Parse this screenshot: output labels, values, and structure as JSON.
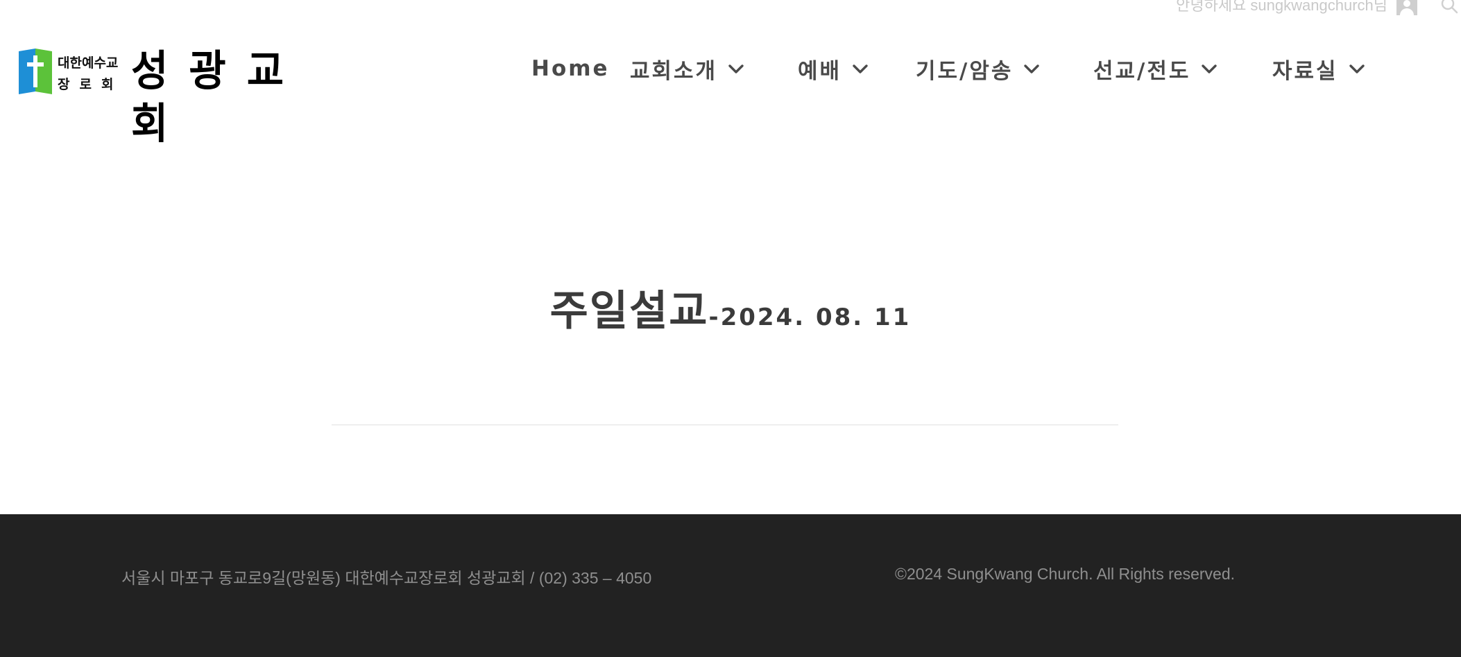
{
  "topbar": {
    "greeting": "안녕하세요 sungkwangchurch님",
    "user_icon": "user-icon",
    "search_icon": "search-icon"
  },
  "logo": {
    "denomination_line1": "대한예수교",
    "denomination_line2": "장로회",
    "church_name": "성광교회",
    "cross_colors": [
      "#1e8fd6",
      "#5cc23a"
    ]
  },
  "nav": {
    "items": [
      {
        "label": "Home",
        "has_dropdown": false
      },
      {
        "label": "교회소개",
        "has_dropdown": true
      },
      {
        "label": "예배",
        "has_dropdown": true
      },
      {
        "label": "기도/암송",
        "has_dropdown": true
      },
      {
        "label": "선교/전도",
        "has_dropdown": true
      },
      {
        "label": "자료실",
        "has_dropdown": true
      }
    ],
    "dropdown_icon": "chevron-down-icon"
  },
  "page": {
    "title": "주일설교",
    "date": "-2024. 08. 11"
  },
  "footer": {
    "address": "서울시 마포구 동교로9길(망원동) 대한예수교장로회 성광교회 / (02) 335 – 4050",
    "copyright": "©2024 SungKwang Church. All Rights reserved.",
    "background": "#222222"
  }
}
